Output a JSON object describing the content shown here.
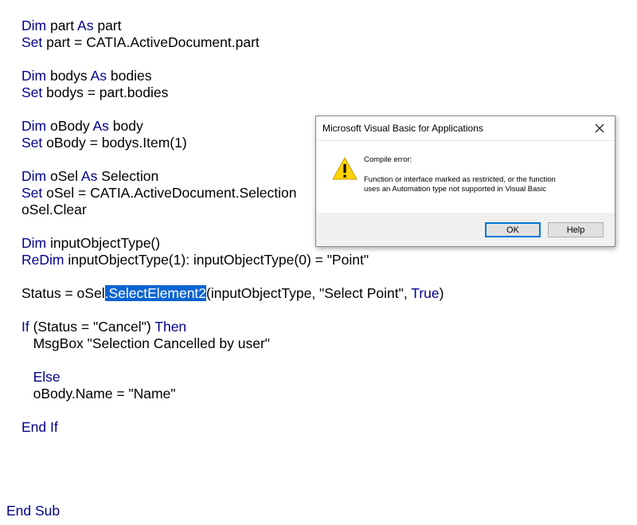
{
  "code": {
    "line1": {
      "k1": "Dim",
      "t1": " part ",
      "k2": "As",
      "t2": " part"
    },
    "line2": {
      "k1": "Set",
      "t1": " part = CATIA.ActiveDocument.part"
    },
    "line3": {
      "k1": "Dim",
      "t1": " bodys ",
      "k2": "As",
      "t2": " bodies"
    },
    "line4": {
      "k1": "Set",
      "t1": " bodys = part.bodies"
    },
    "line5": {
      "k1": "Dim",
      "t1": " oBody ",
      "k2": "As",
      "t2": " body"
    },
    "line6": {
      "k1": "Set",
      "t1": " oBody = bodys.Item(1)"
    },
    "line7": {
      "k1": "Dim",
      "t1": " oSel ",
      "k2": "As",
      "t2": " Selection"
    },
    "line8": {
      "k1": "Set",
      "t1": " oSel = CATIA.ActiveDocument.Selection"
    },
    "line9": {
      "t1": "oSel.Clear"
    },
    "line10": {
      "k1": "Dim",
      "t1": " inputObjectType()"
    },
    "line11": {
      "k1": "ReDim",
      "t1": " inputObjectType(1): inputObjectType(0) = \"Point\""
    },
    "line12": {
      "t1": "Status = oSel",
      "sel": ".SelectElement2",
      "t2": "(inputObjectType, \"Select Point\", ",
      "k1": "True",
      "t3": ")"
    },
    "line13": {
      "k1": "If",
      "t1": " (Status = \"Cancel\") ",
      "k2": "Then"
    },
    "line14": {
      "t1": "   MsgBox \"Selection Cancelled by user\""
    },
    "line15": {
      "k1": "   Else"
    },
    "line16": {
      "t1": "   oBody.Name = \"Name\""
    },
    "line17": {
      "k1": "End If"
    },
    "line18": {
      "k1": "End Sub"
    }
  },
  "dialog": {
    "title": "Microsoft Visual Basic for Applications",
    "heading": "Compile error:",
    "message_line1": "Function or interface marked as restricted, or the function",
    "message_line2": "uses an Automation type not supported in Visual Basic",
    "ok_label": "OK",
    "help_label": "Help",
    "close_icon": "close-icon",
    "warning_icon": "warning-icon"
  },
  "colors": {
    "keyword": "#00008b",
    "selection": "#0a64d2",
    "ok_focus_border": "#0078d7"
  }
}
